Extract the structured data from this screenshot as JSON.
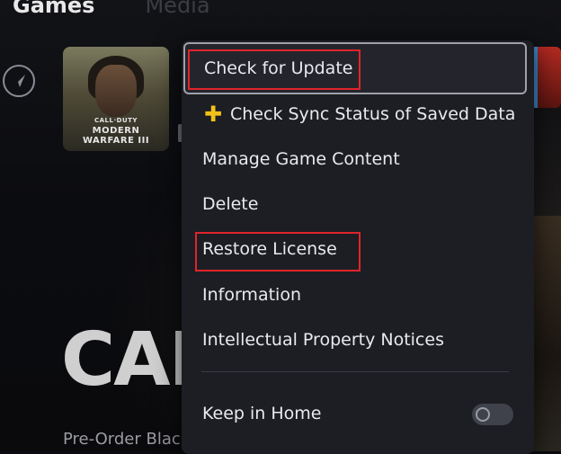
{
  "top_tabs": {
    "games": "Games",
    "media": "Media"
  },
  "game_tile": {
    "logo_line1": "CALL·DUTY",
    "logo_line2": "MODERN",
    "logo_line3": "WARFARE III"
  },
  "background": {
    "big_title": "CALL",
    "preorder_text": "Pre-Order Blac"
  },
  "menu": {
    "items": [
      {
        "label": "Check for Update",
        "focused": true,
        "highlighted": true
      },
      {
        "label": "Check Sync Status of Saved Data",
        "icon": "ps-plus-icon",
        "highlighted": false
      },
      {
        "label": "Manage Game Content",
        "highlighted": false
      },
      {
        "label": "Delete",
        "highlighted": false
      },
      {
        "label": "Restore License",
        "highlighted": true
      },
      {
        "label": "Information",
        "highlighted": false
      },
      {
        "label": "Intellectual Property Notices",
        "highlighted": false
      }
    ],
    "keep_in_home": {
      "label": "Keep in Home",
      "enabled": false
    }
  },
  "colors": {
    "menu_bg": "#1d1e24",
    "highlight": "#e0242c",
    "ps_plus": "#f3c21a"
  }
}
